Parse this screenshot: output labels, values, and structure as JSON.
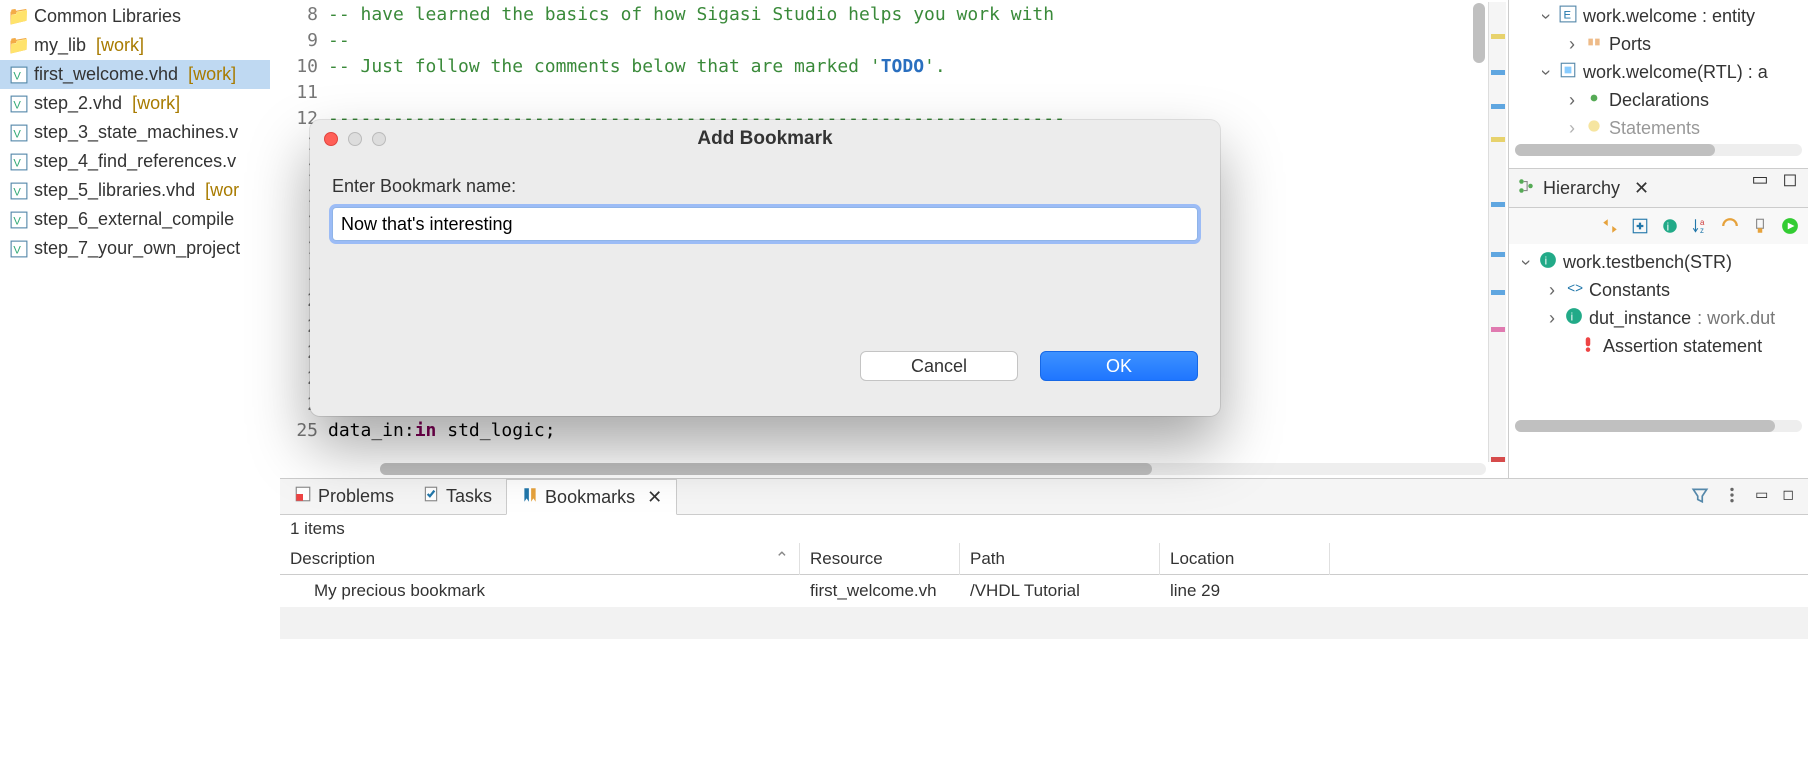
{
  "explorer": {
    "items": [
      {
        "label": "Common Libraries",
        "type": "folder"
      },
      {
        "label": "my_lib",
        "lib": "[work]",
        "type": "folder"
      },
      {
        "label": "first_welcome.vhd",
        "lib": "[work]",
        "type": "vhd",
        "selected": true
      },
      {
        "label": "step_2.vhd",
        "lib": "[work]",
        "type": "vhd"
      },
      {
        "label": "step_3_state_machines.v",
        "lib": "",
        "type": "vhd"
      },
      {
        "label": "step_4_find_references.v",
        "lib": "",
        "type": "vhd"
      },
      {
        "label": "step_5_libraries.vhd",
        "lib": "[wor",
        "type": "vhd"
      },
      {
        "label": "step_6_external_compile",
        "lib": "",
        "type": "vhd"
      },
      {
        "label": "step_7_your_own_project",
        "lib": "",
        "type": "vhd"
      }
    ]
  },
  "editor": {
    "lines": [
      {
        "n": 8,
        "text": "-- have learned the basics of how Sigasi Studio helps you work with ",
        "cls": "comment"
      },
      {
        "n": 9,
        "text": "--",
        "cls": "comment"
      },
      {
        "n": 10,
        "text_pre": "-- Just follow the comments below that are marked '",
        "todo": "TODO",
        "text_post": "'.",
        "cls": "comment"
      },
      {
        "n": 11,
        "text": "",
        "cls": ""
      },
      {
        "n": 12,
        "text": "--------------------------------------------------------------------",
        "cls": "comment"
      },
      {
        "n": 13,
        "text_hidden": true
      },
      {
        "n": 14,
        "text_hidden": true
      },
      {
        "n": 15,
        "text_hidden": true
      },
      {
        "n": 16,
        "text_hidden": true
      },
      {
        "n": 17,
        "text_hidden": true
      },
      {
        "n": 18,
        "text_hidden": true
      },
      {
        "n": 19,
        "text_hidden": true
      },
      {
        "n": 20,
        "text_hidden": true
      },
      {
        "n": 21,
        "text_hidden": true
      },
      {
        "n": 22,
        "text_hidden": true
      },
      {
        "n": 23,
        "text_hidden": true
      },
      {
        "n": 24,
        "text_hidden": true
      },
      {
        "n": 25,
        "text": "data_in:",
        "kw": "in",
        "text2": " std_logic;",
        "cls": ""
      }
    ]
  },
  "outline": {
    "top": [
      {
        "indent": 0,
        "chev": "v",
        "icon": "entity",
        "label": "work.welcome : entity"
      },
      {
        "indent": 1,
        "chev": ">",
        "icon": "ports",
        "label": "Ports"
      },
      {
        "indent": 0,
        "chev": "v",
        "icon": "arch",
        "label": "work.welcome(RTL) : a"
      },
      {
        "indent": 1,
        "chev": ">",
        "icon": "decl",
        "label": "Declarations"
      },
      {
        "indent": 1,
        "chev": ">",
        "icon": "stmt",
        "label": "Statements"
      }
    ]
  },
  "hierarchy": {
    "title": "Hierarchy",
    "rows": [
      {
        "indent": 0,
        "chev": "v",
        "icon": "arch-g",
        "label": "work.testbench(STR)"
      },
      {
        "indent": 1,
        "chev": ">",
        "icon": "const",
        "label": "Constants"
      },
      {
        "indent": 1,
        "chev": ">",
        "icon": "arch-g",
        "label": "dut_instance",
        "suffix": ": work.dut"
      },
      {
        "indent": 2,
        "chev": "",
        "icon": "excl",
        "label": "Assertion statement"
      }
    ]
  },
  "bottom": {
    "tabs": [
      "Problems",
      "Tasks",
      "Bookmarks"
    ],
    "active": 2,
    "count": "1 items",
    "columns": [
      "Description",
      "Resource",
      "Path",
      "Location"
    ],
    "rows": [
      {
        "desc": "My precious bookmark",
        "res": "first_welcome.vh",
        "path": "/VHDL Tutorial",
        "loc": "line 29"
      }
    ]
  },
  "dialog": {
    "title": "Add Bookmark",
    "label": "Enter Bookmark name:",
    "value": "Now that's interesting",
    "cancel": "Cancel",
    "ok": "OK"
  }
}
